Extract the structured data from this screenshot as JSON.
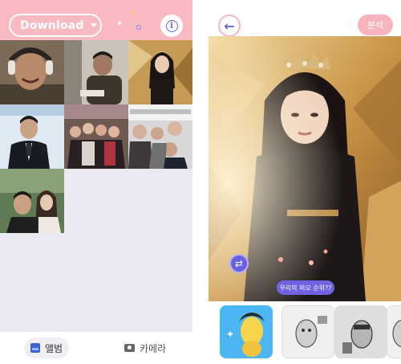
{
  "left": {
    "album_dropdown": {
      "label": "Download",
      "icon": "chevron-down-icon"
    },
    "info_button": {
      "glyph": "i",
      "icon": "info-icon"
    },
    "tabs": [
      {
        "label": "앨범",
        "icon": "album-icon",
        "active": true
      },
      {
        "label": "카메라",
        "icon": "camera-icon",
        "active": false
      }
    ]
  },
  "right": {
    "back_button": {
      "glyph": "←",
      "icon": "arrow-left-icon"
    },
    "analyze_button": {
      "label": "분석"
    },
    "swap_button": {
      "icon": "swap-icon",
      "glyph": "⇄"
    },
    "question_bubble": {
      "text": "우리의 외모 순위??"
    }
  },
  "colors": {
    "header_pink": "#f8b9c1",
    "accent_purple": "#6b63d9",
    "selected_card_blue": "#4bb6f2"
  }
}
